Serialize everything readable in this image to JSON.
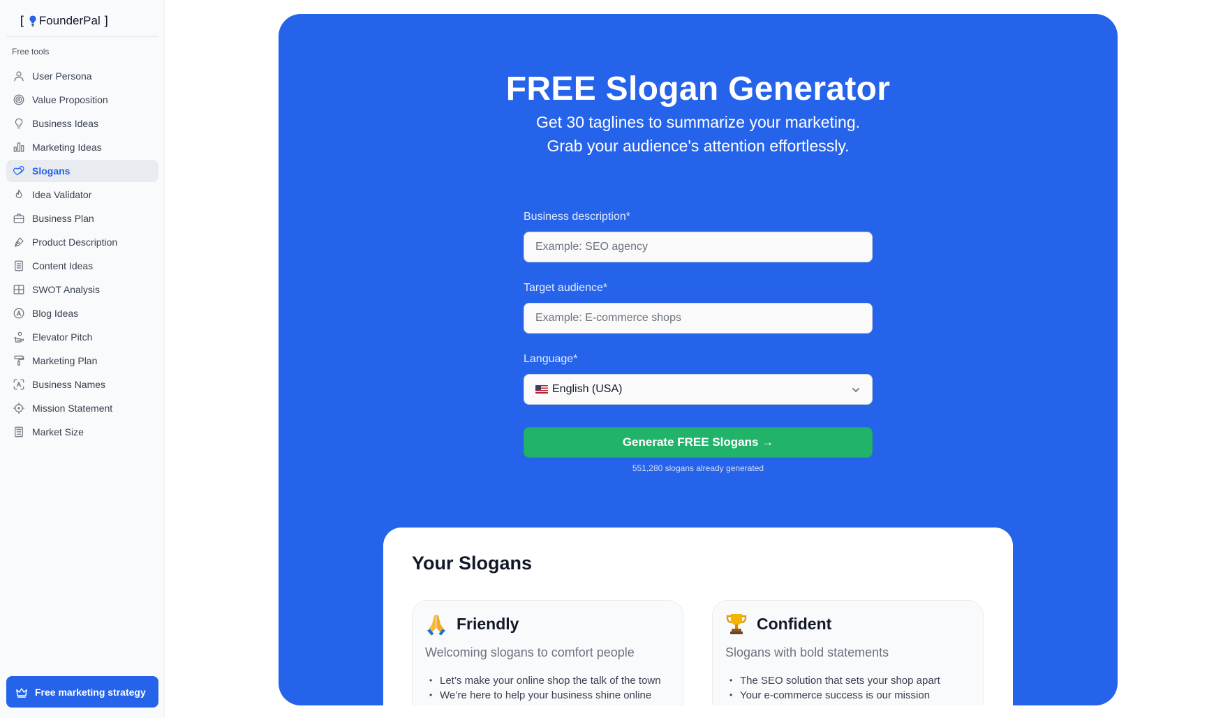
{
  "brand": {
    "bracket_open": "[",
    "name": "FounderPal",
    "bracket_close": "]",
    "icon": "lightbulb-icon"
  },
  "sidebar": {
    "section_label": "Free tools",
    "items": [
      {
        "label": "User Persona",
        "icon": "user-icon",
        "active": false
      },
      {
        "label": "Value Proposition",
        "icon": "target-icon",
        "active": false
      },
      {
        "label": "Business Ideas",
        "icon": "lightbulb-icon",
        "active": false
      },
      {
        "label": "Marketing Ideas",
        "icon": "bar-chart-icon",
        "active": false
      },
      {
        "label": "Slogans",
        "icon": "hearts-icon",
        "active": true
      },
      {
        "label": "Idea Validator",
        "icon": "flame-icon",
        "active": false
      },
      {
        "label": "Business Plan",
        "icon": "briefcase-icon",
        "active": false
      },
      {
        "label": "Product Description",
        "icon": "pen-nib-icon",
        "active": false
      },
      {
        "label": "Content Ideas",
        "icon": "document-icon",
        "active": false
      },
      {
        "label": "SWOT Analysis",
        "icon": "grid-icon",
        "active": false
      },
      {
        "label": "Blog Ideas",
        "icon": "circle-a-icon",
        "active": false
      },
      {
        "label": "Elevator Pitch",
        "icon": "hand-coins-icon",
        "active": false
      },
      {
        "label": "Marketing Plan",
        "icon": "paint-roller-icon",
        "active": false
      },
      {
        "label": "Business Names",
        "icon": "scan-text-icon",
        "active": false
      },
      {
        "label": "Mission Statement",
        "icon": "crosshair-icon",
        "active": false
      },
      {
        "label": "Market Size",
        "icon": "calculator-icon",
        "active": false
      }
    ],
    "cta_label": "Free marketing strategy",
    "cta_icon": "crown-icon"
  },
  "hero": {
    "title": "FREE Slogan Generator",
    "subtitle_line1": "Get 30 taglines to summarize your marketing.",
    "subtitle_line2": "Grab your audience's attention effortlessly.",
    "bg_color": "#2563eb"
  },
  "form": {
    "business_label": "Business description*",
    "business_placeholder": "Example: SEO agency",
    "business_value": "",
    "audience_label": "Target audience*",
    "audience_placeholder": "Example: E-commerce shops",
    "audience_value": "",
    "language_label": "Language*",
    "language_value": "English (USA)",
    "language_flag": "us-flag-icon",
    "generate_label": "Generate FREE Slogans →",
    "generate_color": "#21b36a",
    "generated_count": "551,280 slogans already generated"
  },
  "results": {
    "title": "Your Slogans",
    "tones": [
      {
        "emoji": "folded-hands-icon",
        "name": "Friendly",
        "description": "Welcoming slogans to comfort people",
        "slogans": [
          "Let’s make your online shop the talk of the town",
          "We’re here to help your business shine online"
        ]
      },
      {
        "emoji": "trophy-icon",
        "name": "Confident",
        "description": "Slogans with bold statements",
        "slogans": [
          "The SEO solution that sets your shop apart",
          "Your e-commerce success is our mission"
        ]
      }
    ]
  }
}
